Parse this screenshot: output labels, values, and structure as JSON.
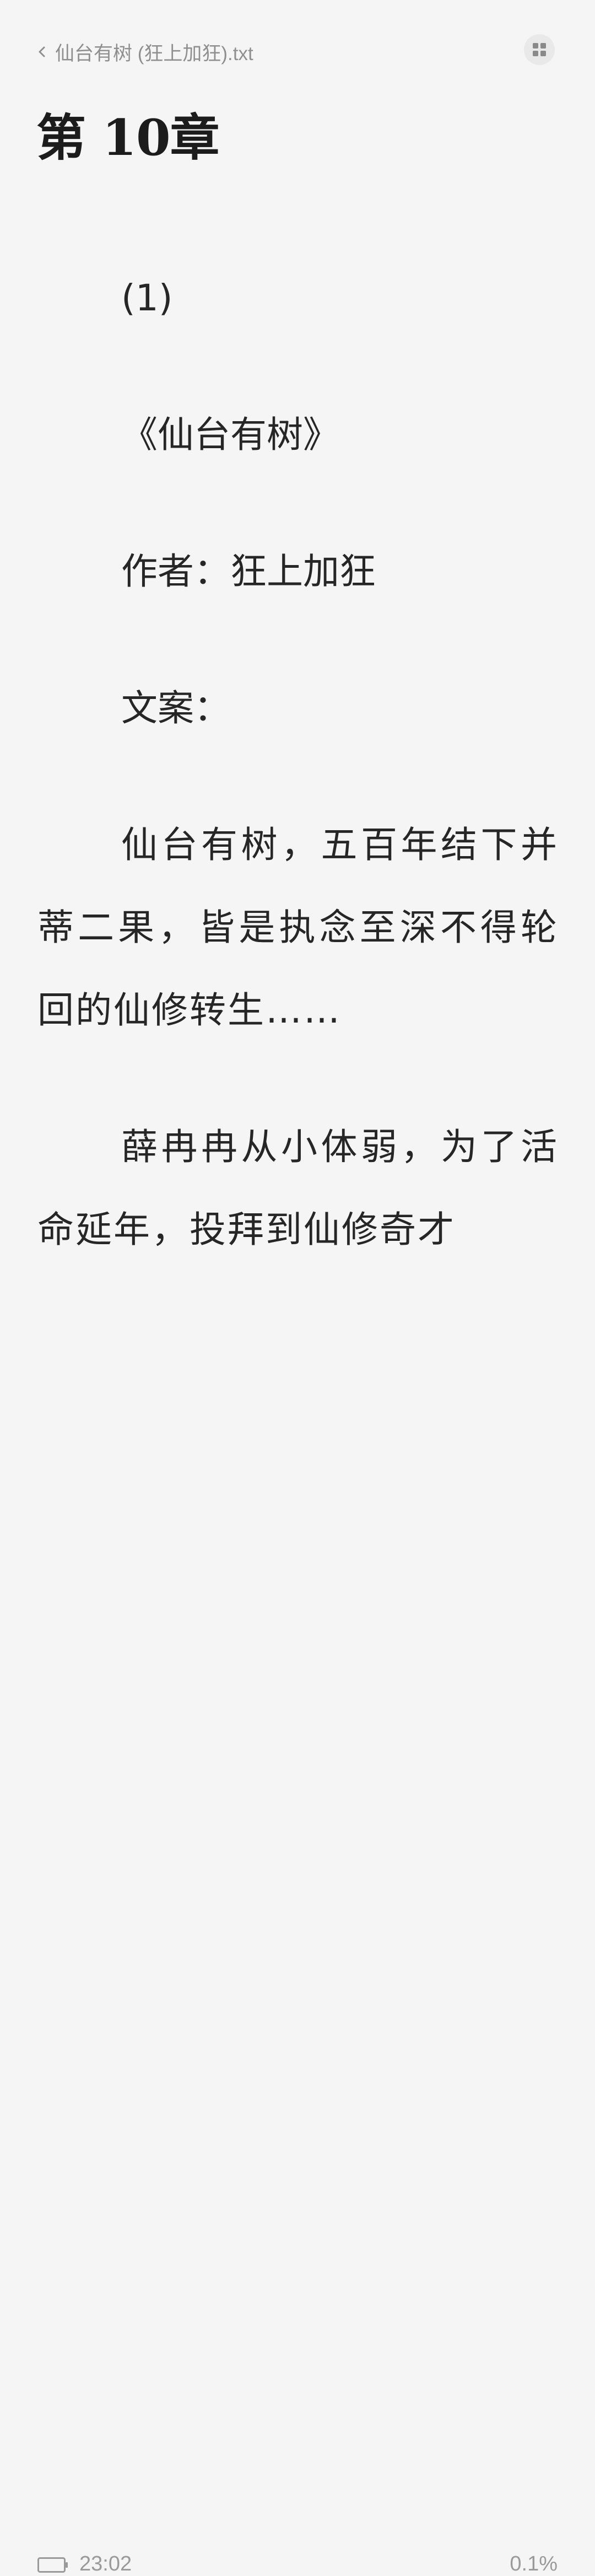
{
  "header": {
    "book_title": "仙台有树 (狂上加狂).txt",
    "back_icon": "chevron-left-icon",
    "menu_icon": "grid-icon"
  },
  "chapter": {
    "title": "第 10章"
  },
  "content": {
    "paragraphs": [
      "(1)",
      "《仙台有树》",
      "作者：狂上加狂",
      "文案：",
      "仙台有树，五百年结下并蒂二果，皆是执念至深不得轮回的仙修转生……",
      "薛冉冉从小体弱，为了活命延年，投拜到仙修奇才"
    ]
  },
  "footer": {
    "battery_icon": "battery-icon",
    "time": "23:02",
    "progress": "0.1%"
  }
}
